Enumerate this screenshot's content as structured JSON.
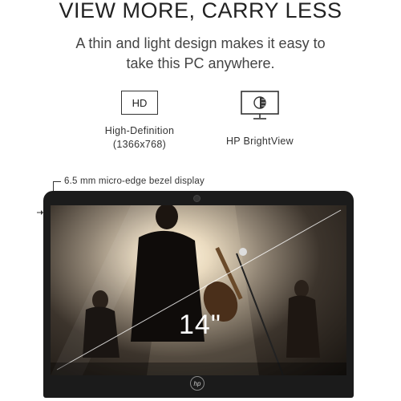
{
  "headline": "VIEW MORE, CARRY LESS",
  "subheadline": "A thin and light design makes it easy to take this PC anywhere.",
  "features": [
    {
      "icon_text": "HD",
      "icon": "hd-icon",
      "label_line1": "High-Definition",
      "label_line2": "(1366x768)"
    },
    {
      "icon": "brightview-monitor-icon",
      "label_line1": "HP BrightView"
    }
  ],
  "bezel_note": "6.5 mm micro-edge bezel display",
  "screen_size": "14\"",
  "logo_text": "hp"
}
